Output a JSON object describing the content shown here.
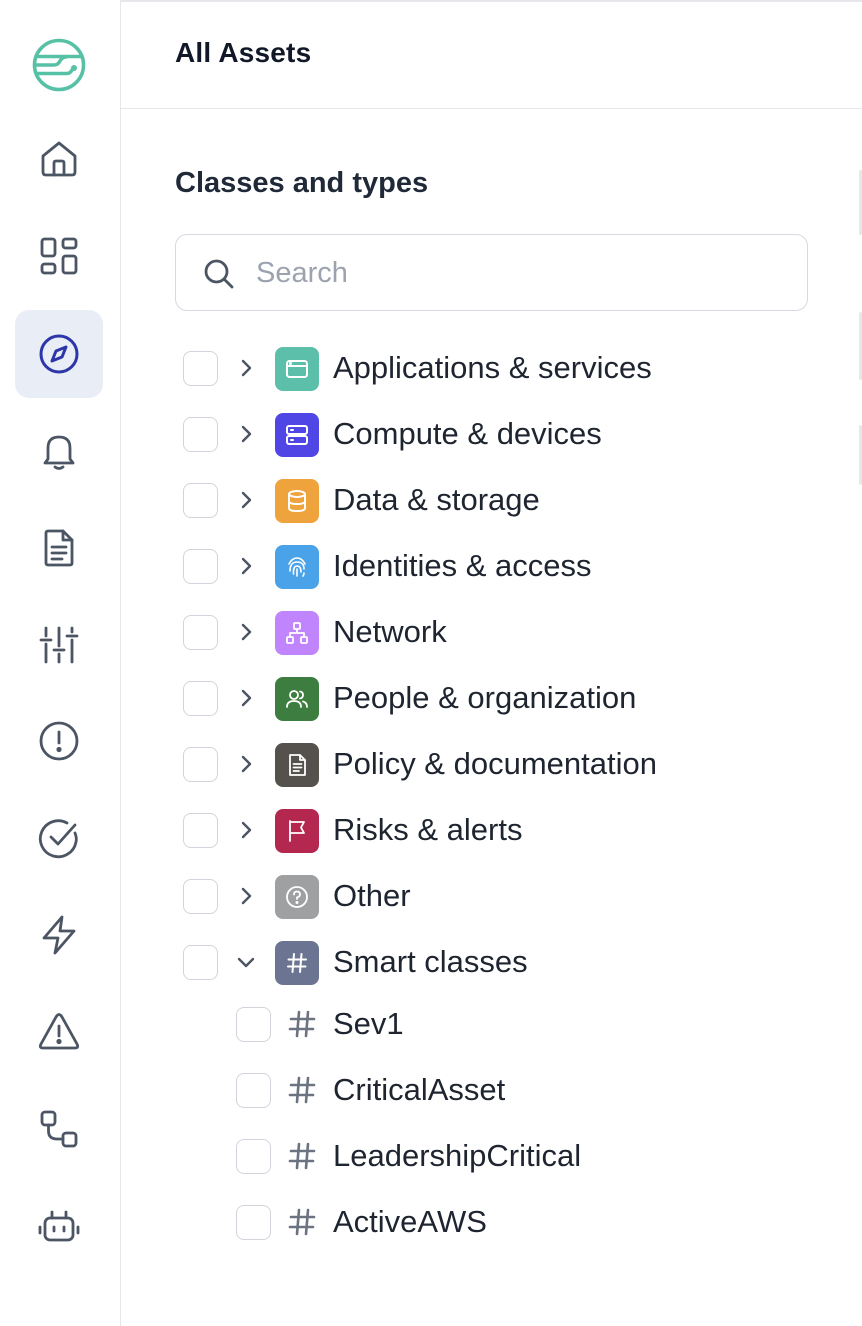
{
  "header": {
    "title": "All Assets"
  },
  "section": {
    "title": "Classes and types"
  },
  "search": {
    "placeholder": "Search",
    "value": ""
  },
  "nav": {
    "items": [
      {
        "icon": "home-icon",
        "active": false
      },
      {
        "icon": "dashboard-icon",
        "active": false
      },
      {
        "icon": "compass-icon",
        "active": true
      },
      {
        "icon": "bell-icon",
        "active": false
      },
      {
        "icon": "document-icon",
        "active": false
      },
      {
        "icon": "sliders-icon",
        "active": false
      },
      {
        "icon": "alert-circle-icon",
        "active": false
      },
      {
        "icon": "check-circle-icon",
        "active": false
      },
      {
        "icon": "lightning-icon",
        "active": false
      },
      {
        "icon": "warning-triangle-icon",
        "active": false
      },
      {
        "icon": "workflow-icon",
        "active": false
      },
      {
        "icon": "robot-icon",
        "active": false
      }
    ]
  },
  "classes": [
    {
      "label": "Applications & services",
      "icon": "app-window-icon",
      "color": "#5cbfa9",
      "expanded": false
    },
    {
      "label": "Compute & devices",
      "icon": "server-icon",
      "color": "#4f46e5",
      "expanded": false
    },
    {
      "label": "Data & storage",
      "icon": "database-icon",
      "color": "#eea33d",
      "expanded": false
    },
    {
      "label": "Identities & access",
      "icon": "fingerprint-icon",
      "color": "#4aa3e8",
      "expanded": false
    },
    {
      "label": "Network",
      "icon": "network-icon",
      "color": "#c084fc",
      "expanded": false
    },
    {
      "label": "People & organization",
      "icon": "people-icon",
      "color": "#3d7d3f",
      "expanded": false
    },
    {
      "label": "Policy & documentation",
      "icon": "policy-doc-icon",
      "color": "#55514d",
      "expanded": false
    },
    {
      "label": "Risks & alerts",
      "icon": "flag-icon",
      "color": "#b4284f",
      "expanded": false
    },
    {
      "label": "Other",
      "icon": "question-icon",
      "color": "#9ea0a2",
      "expanded": false
    },
    {
      "label": "Smart classes",
      "icon": "hash-icon",
      "color": "#6b7591",
      "expanded": true
    }
  ],
  "smart_classes": [
    {
      "label": "Sev1"
    },
    {
      "label": "CriticalAsset"
    },
    {
      "label": "LeadershipCritical"
    },
    {
      "label": "ActiveAWS"
    }
  ],
  "colors": {
    "nav_active_bg": "#e9edf6",
    "nav_active_icon": "#2c36a8",
    "nav_icon": "#4b5563",
    "logo": "#57c1a6"
  }
}
